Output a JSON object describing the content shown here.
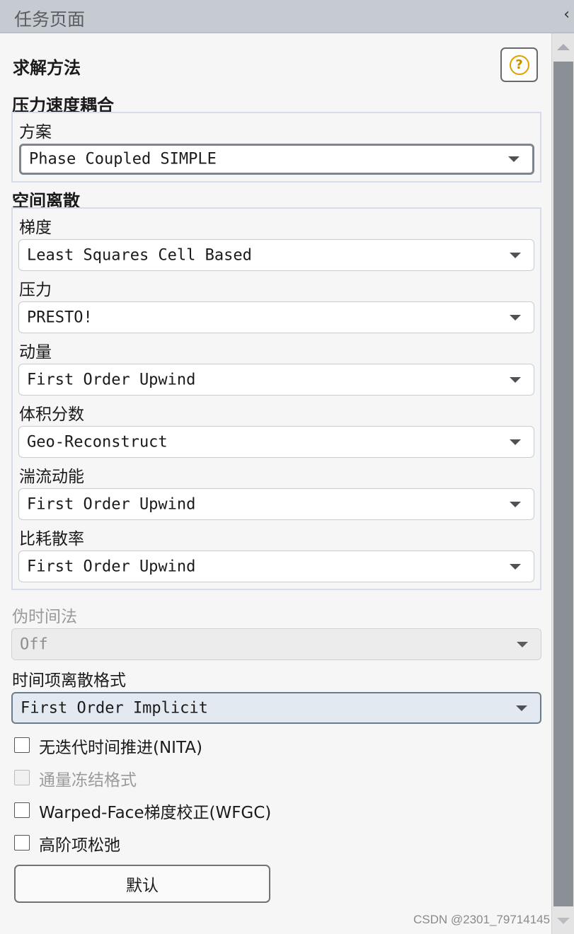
{
  "header": {
    "title": "任务页面",
    "collapse_icon": "chevron-left-icon"
  },
  "solution_methods": {
    "title": "求解方法",
    "help_icon": "help-icon",
    "pv_coupling": {
      "label": "压力速度耦合",
      "scheme_label": "方案",
      "scheme_value": "Phase Coupled SIMPLE"
    },
    "spatial_discretization": {
      "label": "空间离散",
      "gradient_label": "梯度",
      "gradient_value": "Least Squares Cell Based",
      "pressure_label": "压力",
      "pressure_value": "PRESTO!",
      "momentum_label": "动量",
      "momentum_value": "First Order Upwind",
      "volume_fraction_label": "体积分数",
      "volume_fraction_value": "Geo-Reconstruct",
      "tke_label": "湍流动能",
      "tke_value": "First Order Upwind",
      "dissipation_label": "比耗散率",
      "dissipation_value": "First Order Upwind"
    },
    "pseudo_time": {
      "label": "伪时间法",
      "value": "Off"
    },
    "transient": {
      "label": "时间项离散格式",
      "value": "First Order Implicit"
    },
    "checkboxes": [
      {
        "label": "无迭代时间推进(NITA)",
        "checked": false,
        "enabled": true
      },
      {
        "label": "通量冻结格式",
        "checked": false,
        "enabled": false
      },
      {
        "label": "Warped-Face梯度校正(WFGC)",
        "checked": false,
        "enabled": true
      },
      {
        "label": "高阶项松弛",
        "checked": false,
        "enabled": true
      }
    ],
    "default_button": "默认"
  },
  "watermark": "CSDN @2301_79714145"
}
